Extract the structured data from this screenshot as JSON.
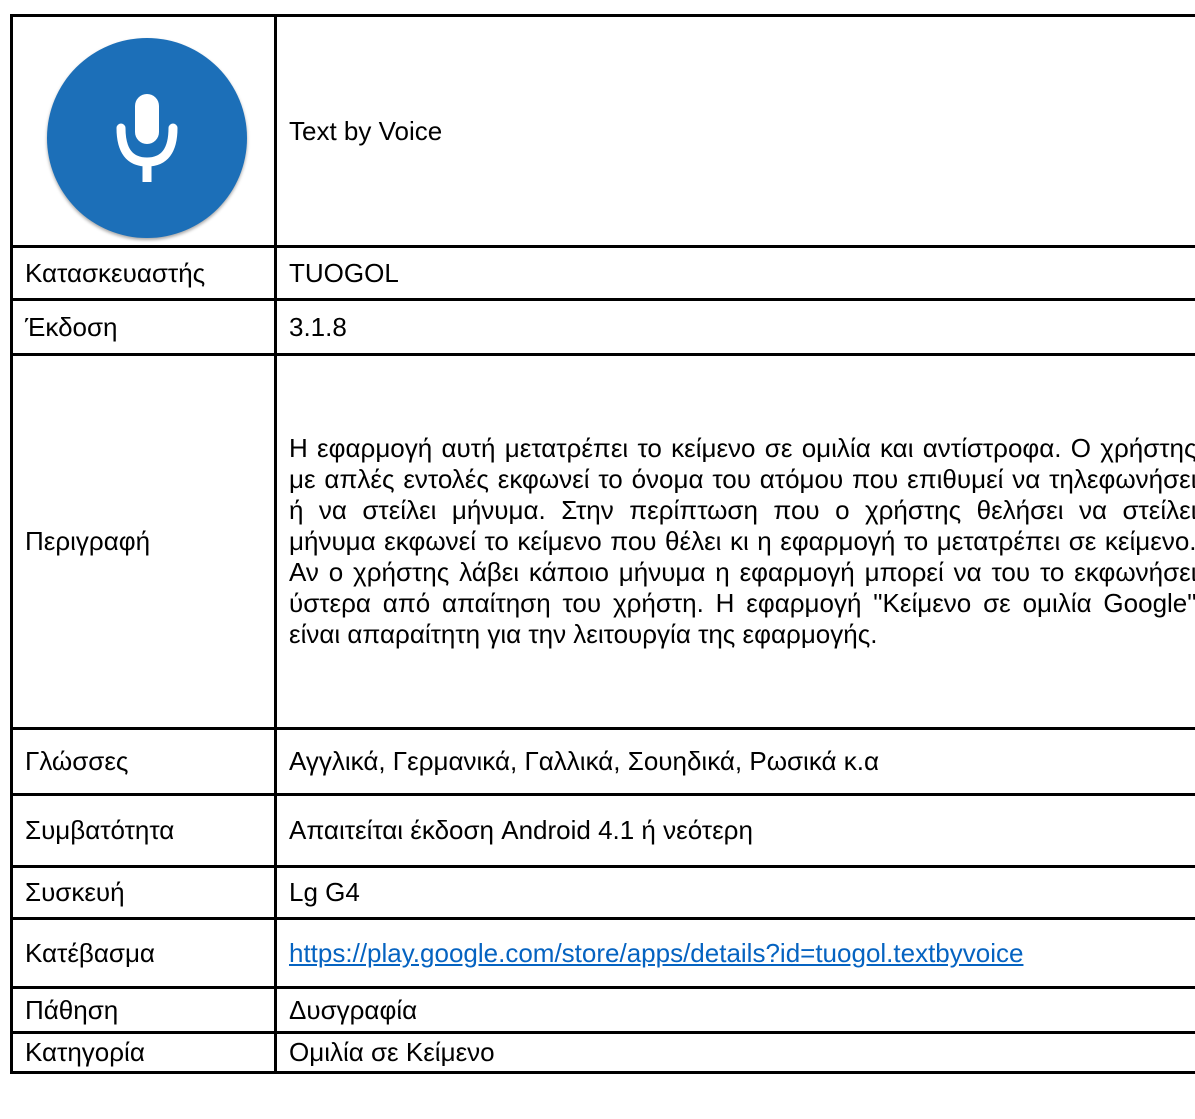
{
  "app": {
    "name": "Text by Voice",
    "logo_icon": "microphone-icon",
    "logo_color": "#1c6fb8"
  },
  "rows": [
    {
      "label": "Κατασκευαστής",
      "value": "TUOGOL"
    },
    {
      "label": "Έκδοση",
      "value": "3.1.8"
    },
    {
      "label": "Περιγραφή",
      "value": "Η εφαρμογή αυτή μετατρέπει το κείμενο σε ομιλία και αντίστροφα. Ο χρήστης με απλές εντολές εκφωνεί το όνομα του ατόμου που επιθυμεί να τηλεφωνήσει ή να στείλει μήνυμα. Στην περίπτωση που ο χρήστης θελήσει να στείλει μήνυμα εκφωνεί το κείμενο που θέλει κι η εφαρμογή το μετατρέπει σε κείμενο. Αν ο χρήστης λάβει κάποιο μήνυμα η εφαρμογή μπορεί να του το εκφωνήσει ύστερα από απαίτηση του χρήστη.  Η εφαρμογή \"Κείμενο σε ομιλία Google\" είναι απαραίτητη για την λειτουργία της εφαρμογής."
    },
    {
      "label": "Γλώσσες",
      "value": "Αγγλικά, Γερμανικά, Γαλλικά, Σουηδικά, Ρωσικά κ.α"
    },
    {
      "label": "Συμβατότητα",
      "value": "Απαιτείται έκδοση Android 4.1 ή νεότερη"
    },
    {
      "label": "Συσκευή",
      "value": "Lg G4"
    },
    {
      "label": "Κατέβασμα",
      "value": "https://play.google.com/store/apps/details?id=tuogol.textbyvoice"
    },
    {
      "label": "Πάθηση",
      "value": "Δυσγραφία"
    },
    {
      "label": "Κατηγορία",
      "value": "Ομιλία σε Κείμενο"
    }
  ]
}
